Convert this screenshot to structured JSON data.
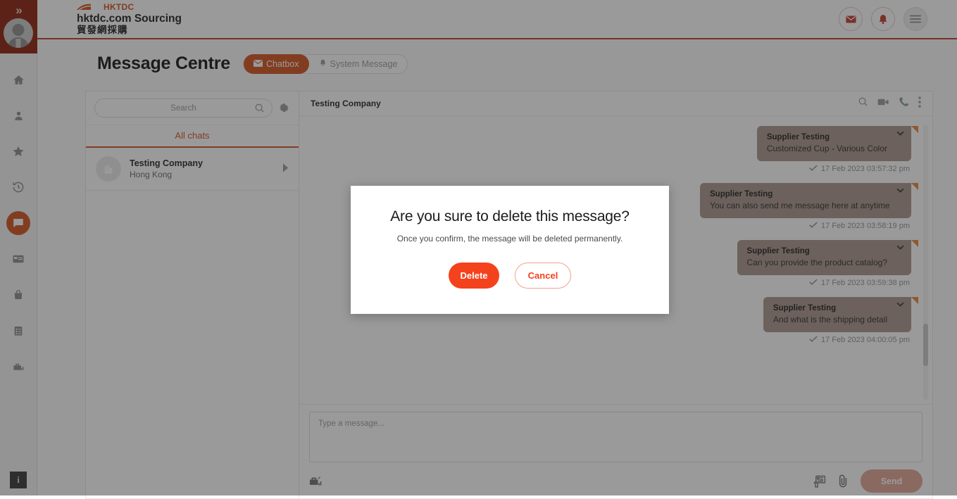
{
  "colors": {
    "brand_orange": "#d2501b",
    "brand_red": "#c0392b",
    "rail_dark_red": "#8c1d09",
    "danger": "#f4421d",
    "bubble": "#a9948a",
    "fold": "#e8833c"
  },
  "header": {
    "logo_text": "HKTDC",
    "brand_name": "hktdc.com Sourcing",
    "brand_name_cn": "貿發網採購",
    "actions": [
      {
        "name": "mail-icon",
        "label": "Mail"
      },
      {
        "name": "bell-icon",
        "label": "Notifications"
      },
      {
        "name": "hamburger-menu-icon",
        "label": "Menu"
      }
    ]
  },
  "rail": {
    "expand_label": "»",
    "items": [
      {
        "name": "home-icon",
        "label": "Home"
      },
      {
        "name": "profile-icon",
        "label": "Profile"
      },
      {
        "name": "star-icon",
        "label": "Favourites"
      },
      {
        "name": "history-icon",
        "label": "History"
      },
      {
        "name": "chat-icon",
        "label": "Messages",
        "active": true
      },
      {
        "name": "card-icon",
        "label": "Cards"
      },
      {
        "name": "bag-icon",
        "label": "Orders"
      },
      {
        "name": "clipboard-icon",
        "label": "Lists"
      },
      {
        "name": "briefcase-icon",
        "label": "Trade"
      }
    ],
    "info_badge": "i"
  },
  "page": {
    "title": "Message Centre",
    "tabs": [
      {
        "label": "Chatbox",
        "icon": "envelope-icon",
        "active": true
      },
      {
        "label": "System Message",
        "icon": "bell-icon",
        "active": false
      }
    ]
  },
  "sidebar": {
    "search": {
      "placeholder": "Search",
      "value": ""
    },
    "settings_icon": "gear-icon",
    "filter_label": "All chats",
    "chats": [
      {
        "name": "Testing Company",
        "location": "Hong Kong"
      }
    ]
  },
  "conversation": {
    "title": "Testing Company",
    "tools": [
      {
        "name": "search-icon",
        "label": "Search"
      },
      {
        "name": "video-camera-icon",
        "label": "Video call"
      },
      {
        "name": "phone-icon",
        "label": "Call"
      },
      {
        "name": "more-options-icon",
        "label": "More"
      }
    ],
    "messages": [
      {
        "sender": "Supplier Testing",
        "text": "Customized Cup - Various Color",
        "time": "17 Feb 2023 03:57:32 pm"
      },
      {
        "sender": "Supplier Testing",
        "text": "You can also send me message here at anytime",
        "time": "17 Feb 2023 03:58:19 pm"
      },
      {
        "sender": "Supplier Testing",
        "text": "Can you provide the product catalog?",
        "time": "17 Feb 2023 03:59:38 pm"
      },
      {
        "sender": "Supplier Testing",
        "text": "And what is the shipping detail",
        "time": "17 Feb 2023 04:00:05 pm"
      }
    ]
  },
  "composer": {
    "placeholder": "Type a message...",
    "value": "",
    "left_icon": "briefcase-chart-icon",
    "right_icons": [
      {
        "name": "quotation-icon",
        "label": "Quotation"
      },
      {
        "name": "attachment-icon",
        "label": "Attach file"
      }
    ],
    "send_label": "Send"
  },
  "modal": {
    "title": "Are you sure to delete this message?",
    "subtitle": "Once you confirm, the message will be deleted permanently.",
    "confirm_label": "Delete",
    "cancel_label": "Cancel"
  }
}
